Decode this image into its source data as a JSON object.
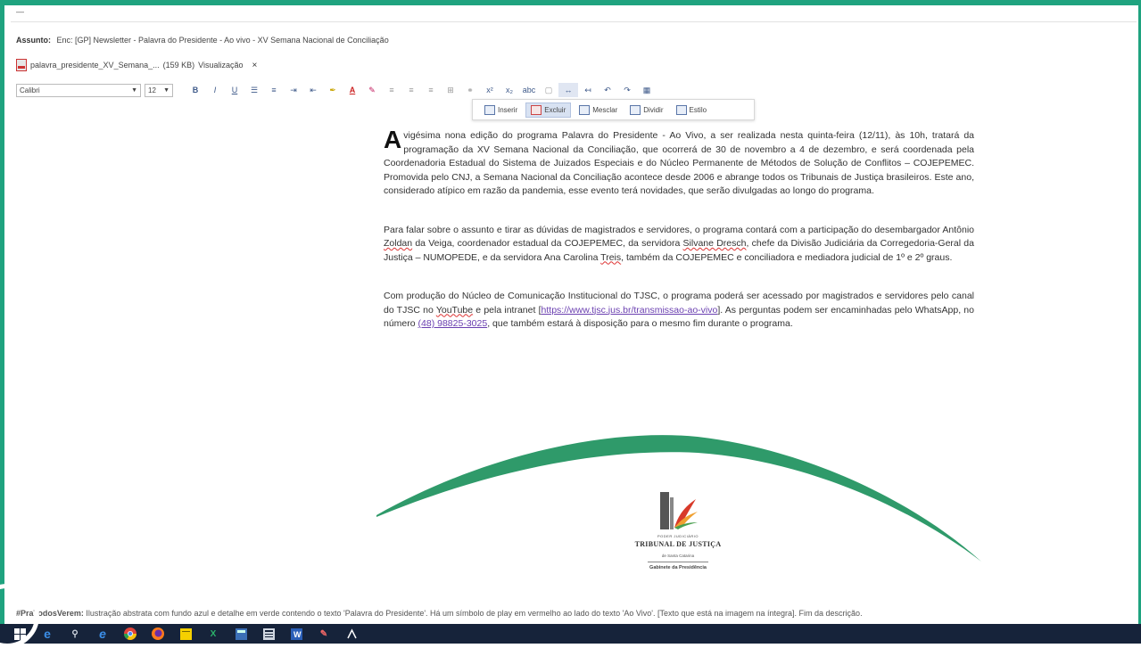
{
  "email": {
    "top_field": "— ",
    "subject_label": "Assunto:",
    "subject": "Enc: [GP] Newsletter - Palavra do Presidente - Ao vivo - XV Semana Nacional de Conciliação",
    "attachment_name": "palavra_presidente_XV_Semana_...",
    "attachment_size": "(159 KB)",
    "attachment_action": "Visualização",
    "attachment_close": "×"
  },
  "toolbar": {
    "font": "Calibri",
    "size": "12",
    "buttons": [
      "B",
      "I",
      "U",
      "☰",
      "≡",
      "⇥",
      "⇤",
      "✒",
      "A",
      "✎",
      "≡",
      "≡",
      "≡",
      "⊞",
      "⚭",
      "x²",
      "x₂",
      "abc",
      "▢",
      "↔",
      "↤",
      "↶",
      "↷",
      "▦"
    ]
  },
  "table_popup": [
    {
      "label": "Inserir",
      "active": false
    },
    {
      "label": "Excluir",
      "active": true
    },
    {
      "label": "Mesclar",
      "active": false
    },
    {
      "label": "Dividir",
      "active": false
    },
    {
      "label": "Estilo",
      "active": false
    }
  ],
  "article": {
    "dropcap": "A",
    "p1": " vigésima nona edição do programa Palavra do Presidente - Ao Vivo, a ser realizada nesta quinta-feira (12/11), às 10h, tratará da programação da XV Semana Nacional da Conciliação, que ocorrerá de 30 de novembro a 4 de dezembro, e será coordenada pela Coordenadoria Estadual do Sistema de Juizados Especiais e do Núcleo Permanente de Métodos de Solução de Conflitos – COJEPEMEC. Promovida pelo CNJ, a Semana Nacional da Conciliação acontece desde 2006 e abrange todos os Tribunais de Justiça brasileiros. Este ano, considerado atípico em razão da pandemia, esse evento terá novidades, que serão divulgadas ao longo do programa.",
    "p2_a": "Para falar sobre o assunto e tirar as dúvidas de magistrados e servidores, o programa contará com a participação do desembargador Antônio ",
    "p2_zoldan": "Zoldan",
    "p2_b": " da Veiga, coordenador estadual da COJEPEMEC, da servidora ",
    "p2_silvane": "Silvane Dresch",
    "p2_c": ", chefe da Divisão Judiciária da Corregedoria-Geral da Justiça – NUMOPEDE, e da servidora Ana Carolina ",
    "p2_treis": "Treis",
    "p2_d": ", também da COJEPEMEC e conciliadora e mediadora judicial de 1º e 2º graus.",
    "p3_a": "Com produção do Núcleo de Comunicação Institucional do TJSC, o programa poderá ser acessado por magistrados e servidores pelo canal do TJSC no ",
    "p3_youtube": "YouTube",
    "p3_b": " e pela intranet [",
    "p3_link": "https://www.tjsc.jus.br/transmissao-ao-vivo",
    "p3_c": "]. As perguntas podem ser encaminhadas pelo WhatsApp, no número ",
    "p3_phone": "(48) 98825-3025",
    "p3_d": ", que também estará à disposição para o mesmo fim durante o programa."
  },
  "logo": {
    "sub1": "PODER JUDICIÁRIO",
    "name": "TRIBUNAL DE JUSTIÇA",
    "sub2": "de Santa Catarina",
    "sub3": "Gabinete da Presidência"
  },
  "alt_text": {
    "label": "#PraTodosVerem:",
    "text": " Ilustração abstrata com fundo azul e detalhe em verde contendo o texto 'Palavra do Presidente'. Há um símbolo de play em vermelho ao lado do texto 'Ao Vivo'. [Texto que está na imagem na íntegra]. Fim da descrição."
  },
  "colors": {
    "frame": "#1fa37f",
    "arc": "#2f9a6a",
    "taskbar": "#16233a"
  },
  "taskbar_icons": [
    "windows-start",
    "edge",
    "pin",
    "ie",
    "chrome",
    "firefox",
    "sticky-notes",
    "excel",
    "calculator",
    "calc-sheet",
    "word",
    "paint",
    "acrobat"
  ]
}
